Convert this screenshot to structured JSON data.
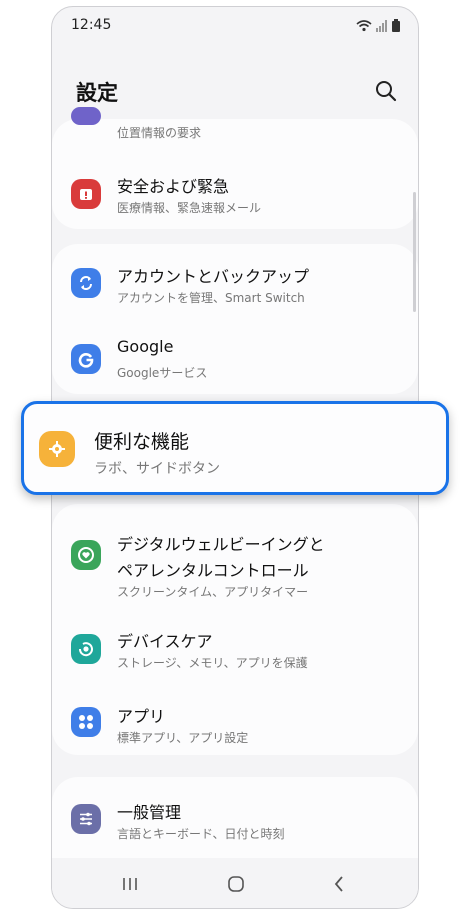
{
  "status_bar": {
    "time": "12:45"
  },
  "header": {
    "title": "設定"
  },
  "items": {
    "location": {
      "sub": "位置情報の要求"
    },
    "safety": {
      "label": "安全および緊急",
      "sub": "医療情報、緊急速報メール",
      "color": "#d93b3b"
    },
    "accounts": {
      "label": "アカウントとバックアップ",
      "sub": "アカウントを管理、Smart Switch",
      "color": "#3f7ee8"
    },
    "google": {
      "label": "Google",
      "sub": "Googleサービス",
      "color": "#3f7ee8"
    },
    "advanced": {
      "label": "便利な機能",
      "sub": "ラボ、サイドボタン",
      "color": "#f6b23a"
    },
    "wellbeing": {
      "label_line1": "デジタルウェルビーイングと",
      "label_line2": "ペアレンタルコントロール",
      "sub": "スクリーンタイム、アプリタイマー",
      "color": "#3aa55a"
    },
    "device_care": {
      "label": "デバイスケア",
      "sub": "ストレージ、メモリ、アプリを保護",
      "color": "#1fa79a"
    },
    "apps": {
      "label": "アプリ",
      "sub": "標準アプリ、アプリ設定",
      "color": "#3f7ee8"
    },
    "general": {
      "label": "一般管理",
      "sub": "言語とキーボード、日付と時刻",
      "color": "#6b6fa8"
    }
  },
  "highlight_color": "#1a73e8"
}
